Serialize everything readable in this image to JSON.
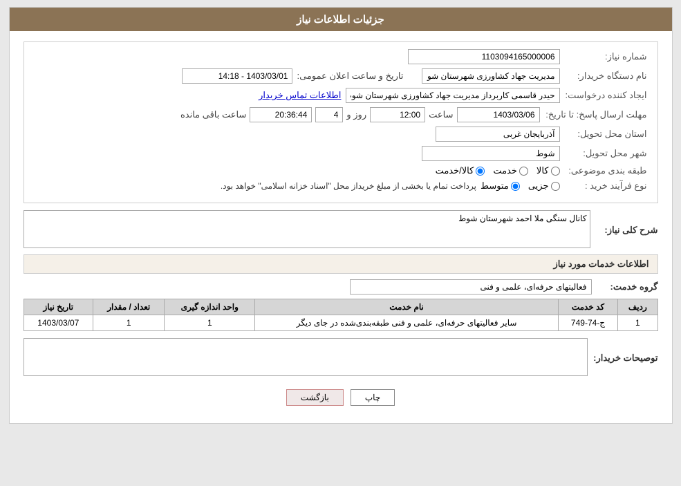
{
  "header": {
    "title": "جزئیات اطلاعات نیاز"
  },
  "fields": {
    "shomareNiaz_label": "شماره نیاز:",
    "shomareNiaz_value": "1103094165000006",
    "namDastgah_label": "نام دستگاه خریدار:",
    "namDastgah_value": "مدیریت جهاد کشاورزی شهرستان شوط",
    "tarikhAelaan_label": "تاریخ و ساعت اعلان عمومی:",
    "tarikhAelaan_value": "1403/03/01 - 14:18",
    "ijadKonande_label": "ایجاد کننده درخواست:",
    "ijadKonande_value": "حیدر قاسمی کاربرداز مدیریت جهاد کشاورزی شهرستان شوط",
    "ettelaatTamas_label": "اطلاعات تماس خریدار",
    "mohlat_label": "مهلت ارسال پاسخ: تا تاریخ:",
    "mohlat_date": "1403/03/06",
    "mohlat_saat_label": "ساعت",
    "mohlat_saat": "12:00",
    "mohlat_rooz_label": "روز و",
    "mohlat_rooz": "4",
    "mohlat_baghimande_label": "ساعت باقی مانده",
    "mohlat_countdown": "20:36:44",
    "ostan_label": "استان محل تحویل:",
    "ostan_value": "آذربایجان غربی",
    "shahr_label": "شهر محل تحویل:",
    "shahr_value": "شوط",
    "tabaqe_label": "طبقه بندی موضوعی:",
    "tabaqe_kala": "کالا",
    "tabaqe_khedmat": "خدمت",
    "tabaqe_kala_khedmat": "کالا/خدمت",
    "noeFarayand_label": "نوع فرآیند خرید :",
    "noeFarayand_jozei": "جزیی",
    "noeFarayand_mottavasset": "متوسط",
    "noeFarayand_notice": "پرداخت تمام یا بخشی از مبلغ خریداز محل \"اسناد خزانه اسلامی\" خواهد بود.",
    "sharhKoli_label": "شرح کلی نیاز:",
    "sharhKoli_value": "کانال سنگی ملا احمد شهرستان شوط",
    "khadamat_label": "اطلاعات خدمات مورد نیاز",
    "groheKhedmat_label": "گروه خدمت:",
    "groheKhedmat_value": "فعالیتهای حرفه‌ای، علمی و فنی",
    "table": {
      "col_radif": "ردیف",
      "col_code": "کد خدمت",
      "col_name": "نام خدمت",
      "col_unit": "واحد اندازه گیری",
      "col_count": "تعداد / مقدار",
      "col_date": "تاریخ نیاز",
      "rows": [
        {
          "radif": "1",
          "code": "ج-74-749",
          "name": "سایر فعالیتهای حرفه‌ای، علمی و فنی طبقه‌بندی‌شده در جای دیگر",
          "unit": "1",
          "count": "1",
          "date": "1403/03/07"
        }
      ]
    },
    "toseeh_label": "توصیحات خریدار:",
    "toseeh_value": ""
  },
  "buttons": {
    "print_label": "چاپ",
    "back_label": "بازگشت"
  }
}
